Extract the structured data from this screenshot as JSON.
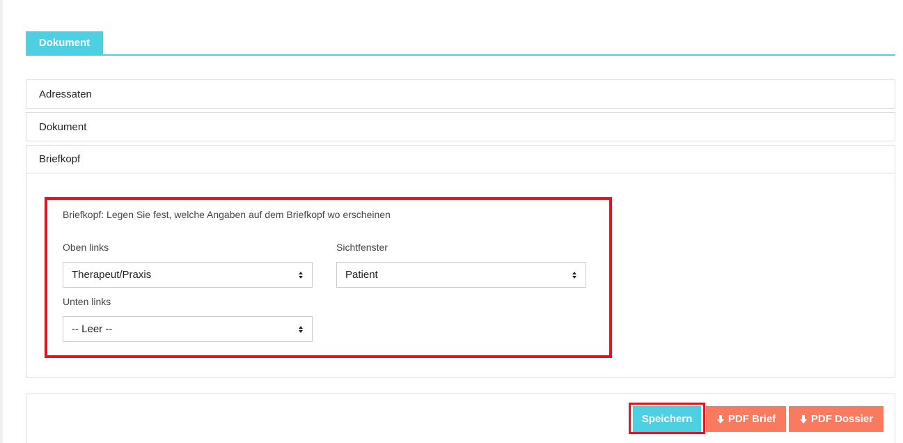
{
  "tabs": [
    {
      "label": "Dokument",
      "active": true
    }
  ],
  "sections": [
    {
      "label": "Adressaten",
      "expanded": false
    },
    {
      "label": "Dokument",
      "expanded": false
    },
    {
      "label": "Briefkopf",
      "expanded": true
    }
  ],
  "briefkopf": {
    "description": "Briefkopf: Legen Sie fest, welche Angaben auf dem Briefkopf wo erscheinen",
    "oben_links": {
      "label": "Oben links",
      "value": "Therapeut/Praxis"
    },
    "sichtfenster": {
      "label": "Sichtfenster",
      "value": "Patient"
    },
    "unten_links": {
      "label": "Unten links",
      "value": "-- Leer --"
    }
  },
  "buttons": {
    "save": "Speichern",
    "pdf_brief": "PDF Brief",
    "pdf_dossier": "PDF Dossier"
  },
  "colors": {
    "accent": "#4dd0e1",
    "pdf": "#fa7a60",
    "highlight": "#e3131f"
  },
  "icons": {
    "select_arrows": "sort-arrows-icon",
    "download": "arrow-down-icon"
  }
}
